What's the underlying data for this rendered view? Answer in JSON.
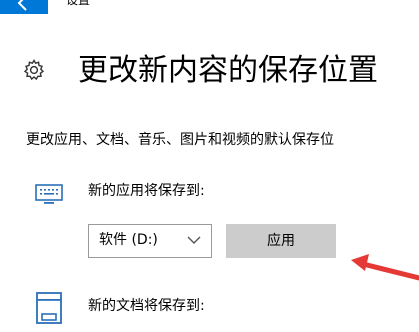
{
  "window": {
    "title": "设置"
  },
  "page": {
    "title": "更改新内容的保存位置",
    "description": "更改应用、文档、音乐、图片和视频的默认保存位"
  },
  "sections": [
    {
      "label": "新的应用将保存到:",
      "icon": "monitor-icon",
      "drive_value": "软件 (D:)",
      "apply_label": "应用"
    },
    {
      "label": "新的文档将保存到:",
      "icon": "document-drive-icon"
    }
  ],
  "icons": {
    "back": "back-arrow-icon",
    "page": "gear-icon"
  },
  "colors": {
    "accent": "#0078d7",
    "button_bg": "#cccccc",
    "annotation_arrow": "#e53935",
    "icon_blue": "#2a6fb8"
  }
}
